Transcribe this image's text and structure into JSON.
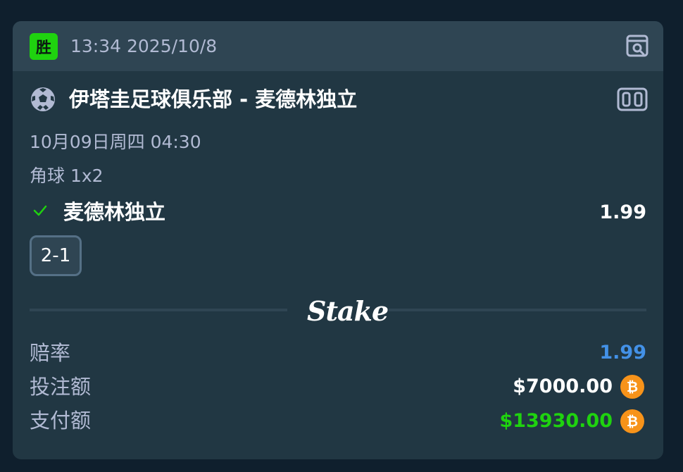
{
  "header": {
    "result_badge": "胜",
    "timestamp": "13:34 2025/10/8",
    "view_icon": "bet-preview-icon"
  },
  "match": {
    "sport_icon": "soccer-ball-icon",
    "title": "伊塔圭足球俱乐部 - 麦德林独立",
    "live_icon": "live-scoreboard-icon",
    "date": "10月09日周四  04:30",
    "market": "角球 1x2",
    "selection": "麦德林独立",
    "selection_odds": "1.99",
    "score": "2-1",
    "status_icon": "check-icon"
  },
  "brand": {
    "logo_text": "Stake"
  },
  "summary": {
    "odds_label": "赔率",
    "odds_value": "1.99",
    "stake_label": "投注额",
    "stake_value": "$7000.00",
    "payout_label": "支付额",
    "payout_value": "$13930.00",
    "currency_icon": "bitcoin-icon"
  },
  "colors": {
    "win_green": "#1fd20f",
    "odds_blue": "#4391e7",
    "payout_green": "#1fd20f",
    "bitcoin_orange": "#f7931a",
    "card_bg": "#213743",
    "header_bg": "#2f4553"
  }
}
